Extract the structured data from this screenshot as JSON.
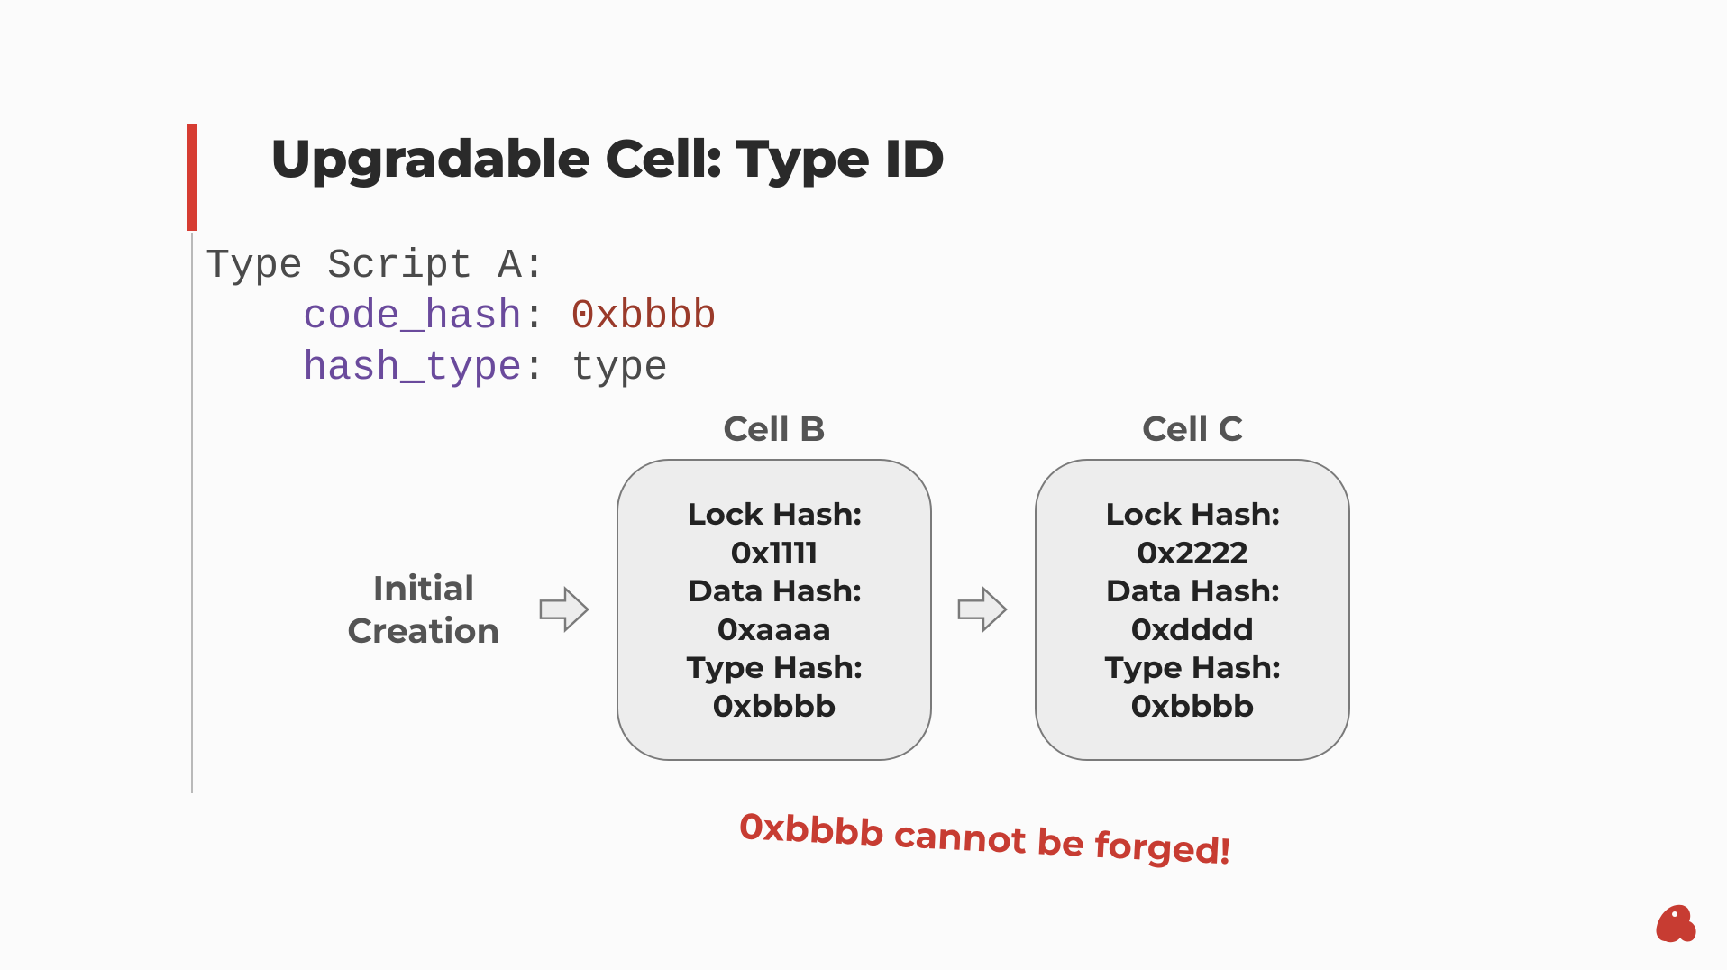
{
  "title": "Upgradable Cell: Type ID",
  "code": {
    "line1": "Type Script A:",
    "line2_key": "code_hash",
    "line2_val": "0xbbbb",
    "line3_key": "hash_type",
    "line3_val": "type"
  },
  "flow": {
    "initial_label_l1": "Initial",
    "initial_label_l2": "Creation",
    "cellB": {
      "label": "Cell B",
      "lock_label": "Lock Hash:",
      "lock_val": "0x1111",
      "data_label": "Data Hash:",
      "data_val": "0xaaaa",
      "type_label": "Type Hash:",
      "type_val": "0xbbbb"
    },
    "cellC": {
      "label": "Cell C",
      "lock_label": "Lock Hash:",
      "lock_val": "0x2222",
      "data_label": "Data Hash:",
      "data_val": "0xdddd",
      "type_label": "Type Hash:",
      "type_val": "0xbbbb"
    }
  },
  "note": "0xbbbb cannot be forged!",
  "colors": {
    "accent_red": "#d63c32",
    "code_key": "#6a4a9c",
    "code_val_red": "#9a3a2a"
  }
}
